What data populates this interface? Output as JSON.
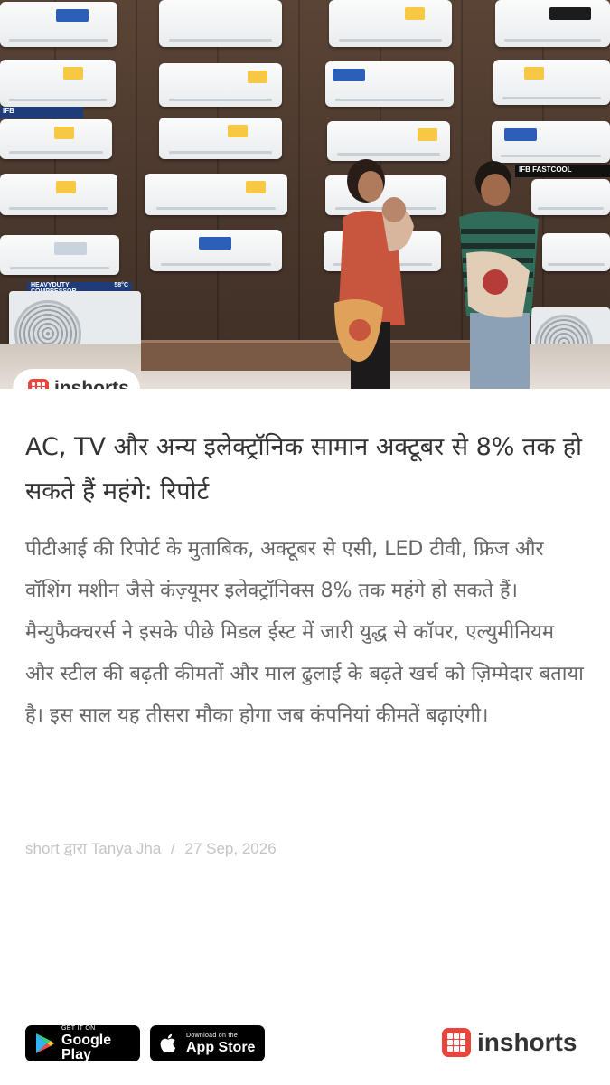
{
  "brand": {
    "name": "inshorts"
  },
  "article": {
    "title": "AC, TV और अन्य इलेक्ट्रॉनिक सामान अक्टूबर से 8% तक हो सकते हैं महंगे: रिपोर्ट",
    "body": "पीटीआई की रिपोर्ट के मुताबिक, अक्टूबर से एसी, LED टीवी, फ्रिज और वॉशिंग मशीन जैसे कंज़्यूमर इलेक्ट्रॉनिक्स 8% तक महंगे हो सकते हैं। मैन्युफैक्चरर्स ने इसके पीछे मिडल ईस्ट में जारी युद्ध से कॉपर, एल्युमीनियम और स्टील की बढ़ती कीमतों और माल ढुलाई के बढ़ते खर्च को ज़िम्मेदार बताया है। इस साल यह तीसरा मौका होगा जब कंपनियां कीमतें बढ़ाएंगी।",
    "byline_prefix": "short द्वारा",
    "author": "Tanya Jha",
    "separator": "/",
    "date": "27 Sep, 2026"
  },
  "photo": {
    "signs": [
      "IFB",
      "HEAVYDUTY COMPRESSOR",
      "58°C",
      "IFB FASTCOOL"
    ]
  },
  "footer": {
    "google_play": {
      "small": "GET IT ON",
      "big": "Google Play"
    },
    "app_store": {
      "small": "Download on the",
      "big": "App Store"
    }
  },
  "colors": {
    "brand_red": "#e8453c",
    "title": "#333333",
    "body": "#666666",
    "byline": "#c4c4c4"
  },
  "icons": [
    "inshorts-logo-icon",
    "google-play-icon",
    "apple-icon"
  ]
}
